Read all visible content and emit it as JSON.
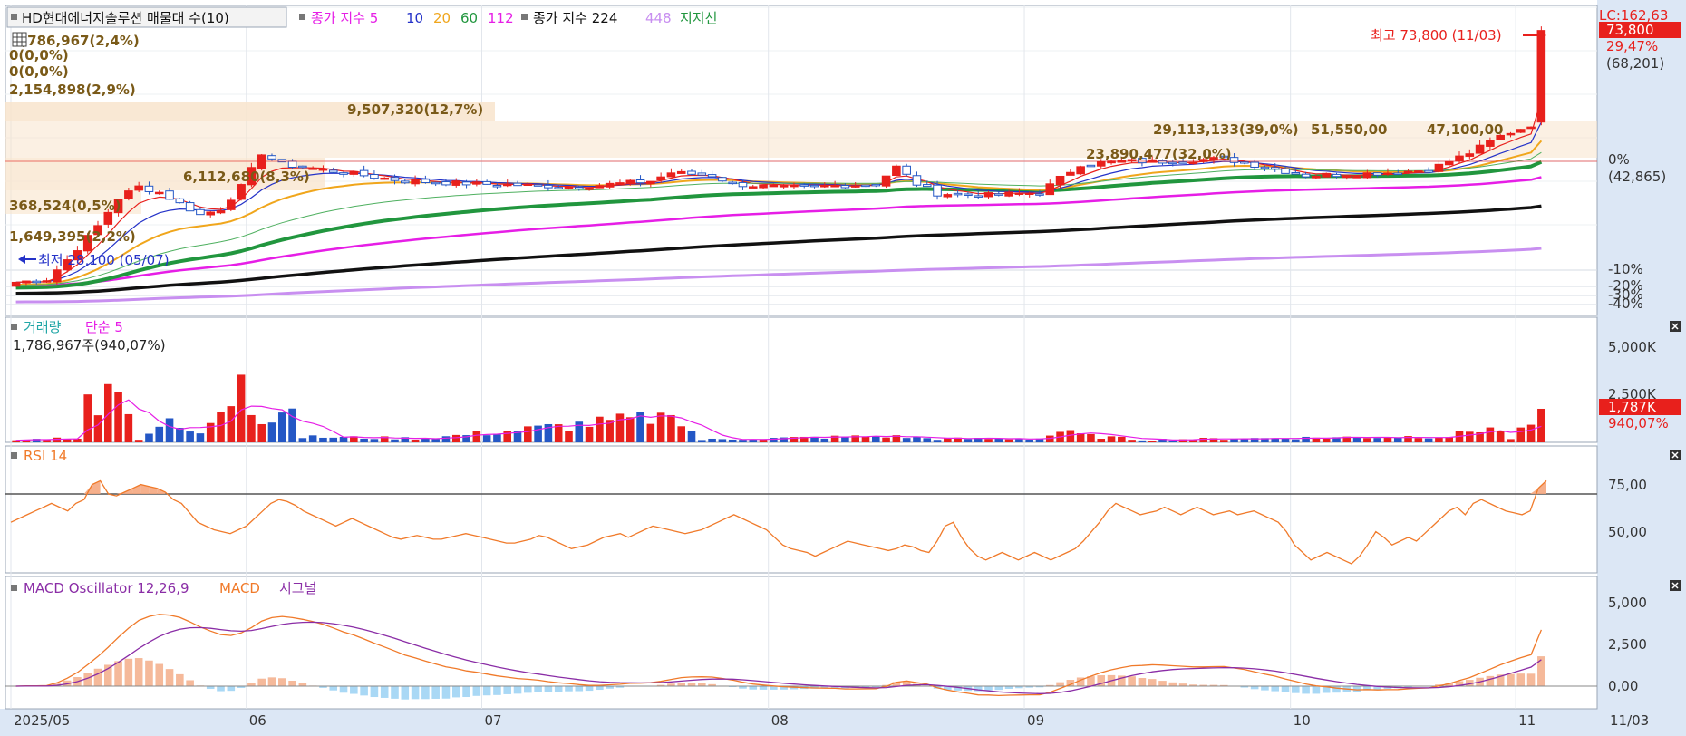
{
  "colors": {
    "up": "#e8201c",
    "down": "#2457c5",
    "ma5": "#e8201c",
    "ma10": "#2432c8",
    "ma20": "#f0a61c",
    "ma60": "#21963e",
    "ma112": "#e61ee6",
    "ma224": "#111111",
    "ma448": "#c88ff0",
    "volume_ma": "#e61ee6",
    "rsi": "#f07a2a",
    "macd": "#f07a2a",
    "signal": "#8a2da6",
    "osc_pos": "#f5b99a",
    "osc_neg": "#a9d8f5",
    "band": "#f8e4cc",
    "axis_bg": "#dce7f5"
  },
  "price_panel": {
    "legend": {
      "stock_title": "HD현대에너지솔루션 매물대 수(10)",
      "ma_label": "종가 지수 5",
      "ma10": "10",
      "ma20": "20",
      "ma60": "60",
      "ma112": "112",
      "ma224_label": "종가 지수 224",
      "ma448": "448",
      "support": "지지선"
    },
    "volume_profile": [
      {
        "label": "1,786,967(2,4%)",
        "icon": "table-icon"
      },
      {
        "label": "0(0,0%)"
      },
      {
        "label": "0(0,0%)"
      },
      {
        "label": "2,154,898(2,9%)"
      },
      {
        "label": "9,507,320(12,7%)"
      },
      {
        "label": "6,112,680(8,3%)"
      },
      {
        "label": "29,113,133(39,0%)"
      },
      {
        "label": "23,890,477(32,0%)"
      },
      {
        "label": "368,524(0,5%)"
      },
      {
        "label": "1,649,395(2,2%)"
      }
    ],
    "annotations": {
      "high": "최고 73,800 (11/03)",
      "low": "최저 28,100 (05/07)",
      "support_a": "51,550,00",
      "support_b": "47,100,00"
    },
    "axis_labels": {
      "lc": "LC:162,63",
      "current_price": "73,800",
      "change_pct": "29,47%",
      "ref_price": "(68,201)",
      "zero_pct": "0%",
      "zero_price": "(42,865)",
      "m10": "-10%",
      "m20": "-20%",
      "m30": "-30%",
      "m40": "-40%"
    }
  },
  "volume_panel": {
    "legend": {
      "volume": "거래량",
      "ma": "단순 5"
    },
    "current": "1,786,967주(940,07%)",
    "axis_labels": {
      "t1": "5,000K",
      "t2": "2,500K",
      "current": "1,787K",
      "pct": "940,07%"
    }
  },
  "rsi_panel": {
    "legend": "RSI 14",
    "axis_labels": {
      "t1": "75,00",
      "t2": "50,00"
    },
    "data": [
      60,
      62,
      64,
      66,
      68,
      70,
      68,
      66,
      70,
      72,
      80,
      82,
      75,
      74,
      76,
      78,
      80,
      79,
      78,
      76,
      72,
      70,
      65,
      60,
      58,
      56,
      55,
      54,
      56,
      58,
      62,
      66,
      70,
      72,
      71,
      69,
      66,
      64,
      62,
      60,
      58,
      60,
      62,
      60,
      58,
      56,
      54,
      52,
      51,
      52,
      53,
      52,
      51,
      51,
      52,
      53,
      54,
      53,
      52,
      51,
      50,
      49,
      49,
      50,
      51,
      53,
      52,
      50,
      48,
      46,
      47,
      48,
      50,
      52,
      53,
      54,
      52,
      54,
      56,
      58,
      57,
      56,
      55,
      54,
      55,
      56,
      58,
      60,
      62,
      64,
      62,
      60,
      58,
      56,
      52,
      48,
      46,
      45,
      44,
      42,
      44,
      46,
      48,
      50,
      49,
      48,
      47,
      46,
      45,
      46,
      48,
      47,
      45,
      44,
      50,
      58,
      60,
      52,
      46,
      42,
      40,
      42,
      44,
      42,
      40,
      42,
      44,
      42,
      40,
      42,
      44,
      46,
      50,
      55,
      60,
      66,
      70,
      68,
      66,
      64,
      65,
      66,
      68,
      66,
      64,
      66,
      68,
      66,
      64,
      65,
      66,
      64,
      65,
      66,
      64,
      62,
      60,
      55,
      48,
      44,
      40,
      42,
      44,
      42,
      40,
      38,
      42,
      48,
      55,
      52,
      48,
      50,
      52,
      50,
      54,
      58,
      62,
      66,
      68,
      64,
      70,
      72,
      70,
      68,
      66,
      65,
      64,
      66,
      78,
      82
    ]
  },
  "macd_panel": {
    "legend": {
      "osc": "MACD Oscillator 12,26,9",
      "macd": "MACD",
      "signal": "시그널"
    },
    "axis_labels": {
      "t1": "5,000",
      "t2": "2,500",
      "t3": "0,00"
    }
  },
  "x_axis": {
    "labels": [
      {
        "text": "2025/05",
        "i": 0
      },
      {
        "text": "06",
        "i": 23
      },
      {
        "text": "07",
        "i": 46
      },
      {
        "text": "08",
        "i": 74
      },
      {
        "text": "09",
        "i": 99
      },
      {
        "text": "10",
        "i": 125
      },
      {
        "text": "11",
        "i": 147
      }
    ],
    "end_label": "11/03"
  },
  "chart_data": {
    "type": "candlestick",
    "series_count": 150,
    "price_range": [
      26000,
      76000
    ],
    "close_keypoints": [
      [
        0,
        29000
      ],
      [
        3,
        29500
      ],
      [
        5,
        33000
      ],
      [
        8,
        39000
      ],
      [
        10,
        44000
      ],
      [
        12,
        46000
      ],
      [
        14,
        45000
      ],
      [
        16,
        43000
      ],
      [
        18,
        41000
      ],
      [
        20,
        42000
      ],
      [
        22,
        46000
      ],
      [
        24,
        52000
      ],
      [
        26,
        50000
      ],
      [
        30,
        49000
      ],
      [
        34,
        48000
      ],
      [
        38,
        47000
      ],
      [
        45,
        46500
      ],
      [
        55,
        46000
      ],
      [
        62,
        47000
      ],
      [
        64,
        48500
      ],
      [
        68,
        48000
      ],
      [
        70,
        46500
      ],
      [
        75,
        45800
      ],
      [
        84,
        46500
      ],
      [
        86,
        49500
      ],
      [
        88,
        46500
      ],
      [
        90,
        44800
      ],
      [
        95,
        44500
      ],
      [
        100,
        45000
      ],
      [
        104,
        50000
      ],
      [
        108,
        50500
      ],
      [
        112,
        50500
      ],
      [
        118,
        51000
      ],
      [
        122,
        49500
      ],
      [
        126,
        48000
      ],
      [
        130,
        48200
      ],
      [
        134,
        48500
      ],
      [
        138,
        49000
      ],
      [
        142,
        52000
      ],
      [
        145,
        55000
      ],
      [
        148,
        57000
      ],
      [
        150,
        73800
      ]
    ],
    "volume_keypoints": [
      [
        0,
        120
      ],
      [
        6,
        280
      ],
      [
        7,
        2550
      ],
      [
        8,
        1350
      ],
      [
        9,
        3100
      ],
      [
        10,
        2700
      ],
      [
        12,
        200
      ],
      [
        15,
        1280
      ],
      [
        16,
        780
      ],
      [
        18,
        420
      ],
      [
        22,
        3600
      ],
      [
        23,
        2000
      ],
      [
        24,
        1100
      ],
      [
        27,
        1800
      ],
      [
        28,
        300
      ],
      [
        40,
        220
      ],
      [
        64,
        1450
      ],
      [
        67,
        150
      ],
      [
        85,
        350
      ],
      [
        90,
        200
      ],
      [
        100,
        210
      ],
      [
        102,
        600
      ],
      [
        105,
        350
      ],
      [
        110,
        150
      ],
      [
        140,
        350
      ],
      [
        142,
        620
      ],
      [
        144,
        850
      ],
      [
        146,
        220
      ],
      [
        150,
        1787
      ]
    ]
  }
}
